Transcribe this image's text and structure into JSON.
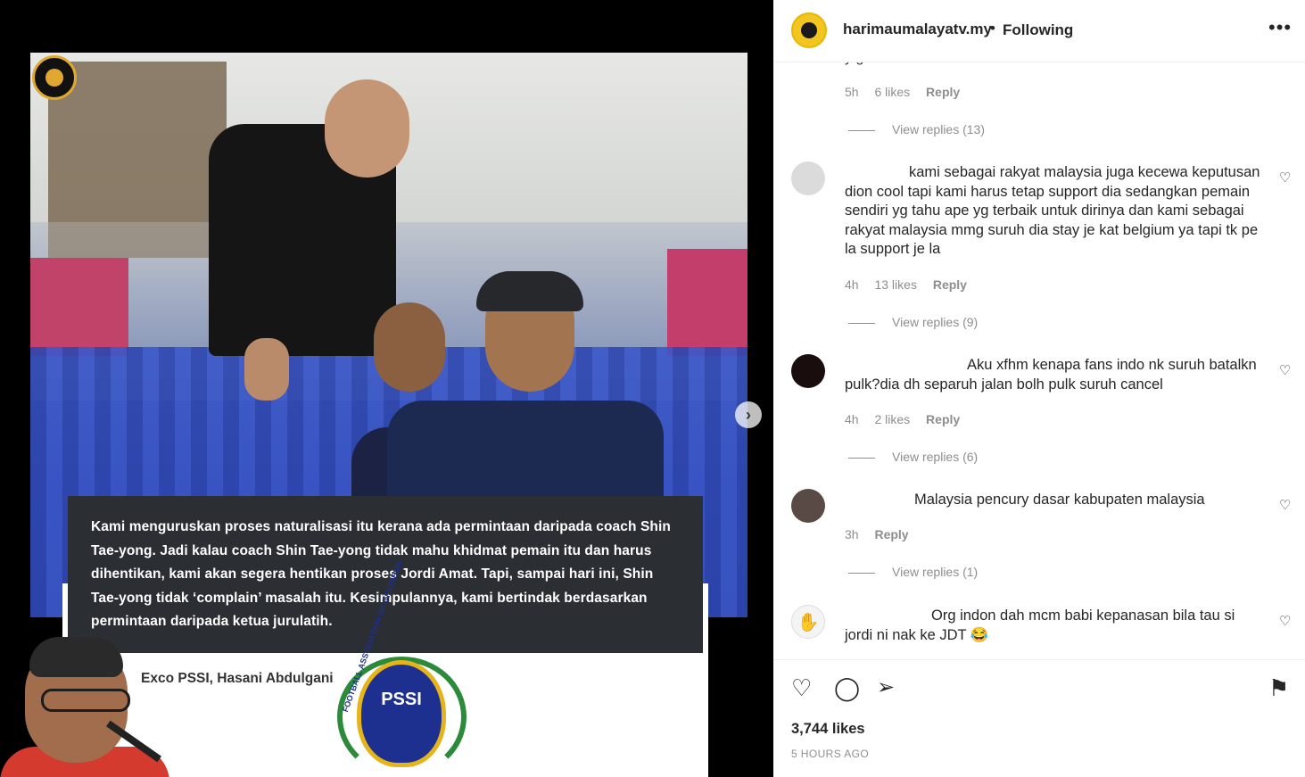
{
  "post": {
    "quote": "Kami menguruskan proses naturalisasi itu kerana ada permintaan daripada coach Shin Tae-yong. Jadi kalau coach Shin Tae-yong tidak mahu khidmat pemain itu dan harus dihentikan, kami akan segera hentikan proses Jordi Amat. Tapi, sampai hari ini, Shin Tae-yong tidak ‘complain’ masalah itu. Kesimpulannya, kami bertindak berdasarkan permintaan daripada ketua jurulatih.",
    "speaker": "Exco PSSI, Hasani Abdulgani",
    "logo_text": "PSSI",
    "logo_ring_text": "FOOTBALL ASSOCIATION OF INDONESIA",
    "next_icon": "chevron-right-icon"
  },
  "header": {
    "username": "harimaumalayatv.my",
    "separator": "•",
    "follow_state": "Following",
    "more_icon": "more-horizontal-icon"
  },
  "comments": [
    {
      "partial_text": "y g",
      "time": "5h",
      "likes": "6 likes",
      "reply": "Reply",
      "view_replies": "View replies (13)"
    },
    {
      "text": "kami sebagai rakyat malaysia juga kecewa keputusan dion cool tapi kami harus tetap support dia sedangkan pemain sendiri yg tahu ape yg terbaik untuk dirinya dan kami sebagai rakyat malaysia mmg suruh dia stay je kat belgium ya tapi tk pe la support je la",
      "time": "4h",
      "likes": "13 likes",
      "reply": "Reply",
      "view_replies": "View replies (9)"
    },
    {
      "text": "Aku xfhm kenapa fans indo nk suruh batalkn pulk?dia dh separuh jalan bolh pulk suruh cancel",
      "time": "4h",
      "likes": "2 likes",
      "reply": "Reply",
      "view_replies": "View replies (6)"
    },
    {
      "text": "Malaysia pencury dasar kabupaten malaysia",
      "time": "3h",
      "likes": "",
      "reply": "Reply",
      "view_replies": "View replies (1)"
    },
    {
      "text": "Org indon dah mcm babi kepanasan bila tau si jordi ni nak ke JDT 😂",
      "time": "",
      "likes": "",
      "reply": "",
      "view_replies": ""
    }
  ],
  "actions": {
    "like_icon": "heart-icon",
    "comment_icon": "comment-icon",
    "share_icon": "send-icon",
    "save_icon": "bookmark-icon",
    "likes": "3,744 likes",
    "time_ago": "5 HOURS AGO"
  },
  "colors": {
    "quote_bg": "#2b2f33",
    "brand_gold": "#f2c521",
    "meta_gray": "#8e8e8e"
  }
}
